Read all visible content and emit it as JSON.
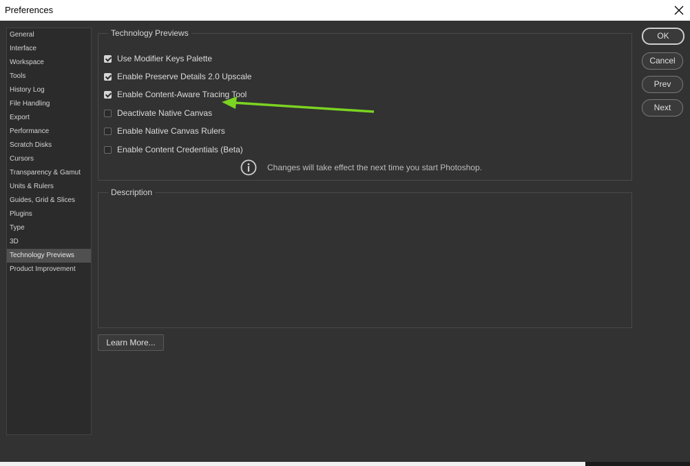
{
  "window": {
    "title": "Preferences"
  },
  "sidebar": {
    "items": [
      {
        "label": "General"
      },
      {
        "label": "Interface"
      },
      {
        "label": "Workspace"
      },
      {
        "label": "Tools"
      },
      {
        "label": "History Log"
      },
      {
        "label": "File Handling"
      },
      {
        "label": "Export"
      },
      {
        "label": "Performance"
      },
      {
        "label": "Scratch Disks"
      },
      {
        "label": "Cursors"
      },
      {
        "label": "Transparency & Gamut"
      },
      {
        "label": "Units & Rulers"
      },
      {
        "label": "Guides, Grid & Slices"
      },
      {
        "label": "Plugins"
      },
      {
        "label": "Type"
      },
      {
        "label": "3D"
      },
      {
        "label": "Technology Previews"
      },
      {
        "label": "Product Improvement"
      }
    ],
    "selected": "Technology Previews"
  },
  "tech_previews": {
    "legend": "Technology Previews",
    "options": [
      {
        "label": "Use Modifier Keys Palette",
        "checked": true
      },
      {
        "label": "Enable Preserve Details 2.0 Upscale",
        "checked": true
      },
      {
        "label": "Enable Content-Aware Tracing Tool",
        "checked": true
      },
      {
        "label": "Deactivate Native Canvas",
        "checked": false
      },
      {
        "label": "Enable Native Canvas Rulers",
        "checked": false
      },
      {
        "label": "Enable Content Credentials (Beta)",
        "checked": false
      }
    ],
    "info_text": "Changes will take effect the next time you start Photoshop."
  },
  "description": {
    "legend": "Description"
  },
  "buttons": {
    "ok": "OK",
    "cancel": "Cancel",
    "prev": "Prev",
    "next": "Next",
    "learn_more": "Learn More..."
  },
  "colors": {
    "annotation_arrow": "#7bd322"
  }
}
